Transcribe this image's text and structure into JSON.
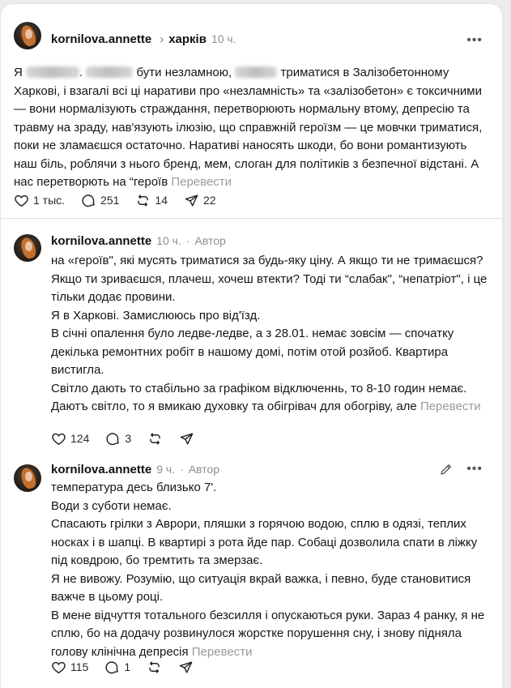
{
  "posts": [
    {
      "username": "kornilova.annette",
      "topic": "харків",
      "time": "10 ч.",
      "text_parts": [
        "Я",
        ". ",
        "бути незламною,",
        " триматися в Залізобетонному Харкові, і взагалі всі ці наративи про «незламність» та «залізобетон» є токсичними — вони нормалізують страждання, перетворюють нормальну втому, депресію та травму на зраду, нав'язують ілюзію, що справжній героїзм — це мовчки триматися, поки не зламаєшся остаточно. Наративі наносять шкоди, бо вони романтизують наш біль, роблячи з нього бренд, мем, слоган для політиків з безпечної відстані. А нас перетворють на “героїв"
      ],
      "translate": "Перевести",
      "likes": "1 тыс.",
      "comments": "251",
      "reposts": "14",
      "shares": "22"
    },
    {
      "username": "kornilova.annette",
      "time": "10 ч.",
      "author_tag": "Автор",
      "paragraphs": [
        "на «героїв\", які мусять триматися за будь-яку ціну. А якщо ти не тримаєшся? Якщо ти зриваєшся, плачеш, хочеш втекти? Тоді ти “слабак\", “непатріот\", і це тільки додає провини.",
        "Я в Харкові. Замислююсь про від'їзд.",
        "В січні опалення було ледве-ледве, а з 28.01. немає зовсім — спочатку декілька ремонтних робіт в нашому домі, потім отой розйоб. Квартира вистигла.",
        "Світло дають то стабільно за графіком відключеннь, то 8-10 годин немає. Даютъ світло, то я вмикаю духовку та обігрівач для обогріву, але"
      ],
      "translate": "Перевести",
      "likes": "124",
      "comments": "3"
    },
    {
      "username": "kornilova.annette",
      "time": "9 ч.",
      "author_tag": "Автор",
      "paragraphs": [
        "температура десь близько 7'.",
        "Води з суботи немає.",
        "Спасають грілки з Аврори, пляшки з горячою водою, сплю в одязі, теплих носках і в шапці. В квартирі з рота йде пар. Собаці дозволила спати в ліжку під ковдрою, бо тремтить та змерзає.",
        "Я не вивожу. Розумію, що ситуація вкрай важка, і певно, буде становитися важче в цьому році.",
        "В мене відчуття тотального безсилля і опускаються руки. Зараз 4 ранку, я не сплю, бо на додачу розвинулося жорстке порушення сну, і знову підняла голову клінічна депресія"
      ],
      "translate": "Перевести",
      "likes": "115",
      "comments": "1"
    }
  ],
  "icons": {
    "like": "heart-icon",
    "comment": "speech-bubble-icon",
    "repost": "repost-arrows-icon",
    "share": "paper-plane-icon",
    "more": "ellipsis-icon",
    "edit": "pencil-icon",
    "topic_separator": "chevron-right-icon"
  },
  "colors": {
    "text": "#161616",
    "muted": "#8e8e8e",
    "translate": "#9a9a9a",
    "background": "#ffffff"
  }
}
